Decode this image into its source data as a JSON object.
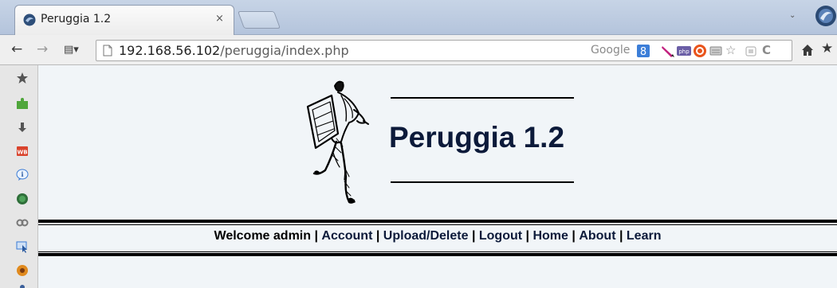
{
  "browser": {
    "tab": {
      "title": "Peruggia 1.2",
      "close_label": "×"
    },
    "chevron_label": "⌄",
    "toolbar": {
      "back_label": "←",
      "forward_label": "→",
      "apps_label": "▤▾",
      "url_host": "192.168.56.102",
      "url_path": "/peruggia/index.php",
      "search_engine_label": "Google",
      "reload_label": "C",
      "star_label": "☆",
      "bookmark_star_label": "★"
    },
    "sidebar_icons": [
      "star-icon",
      "puzzle-icon",
      "download-icon",
      "wb-icon",
      "info-icon",
      "shield-icon",
      "link-icon",
      "pointer-icon",
      "bug-icon",
      "user-icon"
    ]
  },
  "page": {
    "site_title": "Peruggia 1.2",
    "welcome_text": "Welcome admin",
    "nav_links": [
      {
        "label": "Account"
      },
      {
        "label": "Upload/Delete"
      },
      {
        "label": "Logout"
      },
      {
        "label": "Home"
      },
      {
        "label": "About"
      },
      {
        "label": "Learn"
      }
    ],
    "separator": "|"
  },
  "colors": {
    "title": "#0c1a3a",
    "page_background": "#f1f5f8",
    "rule": "#000000"
  }
}
